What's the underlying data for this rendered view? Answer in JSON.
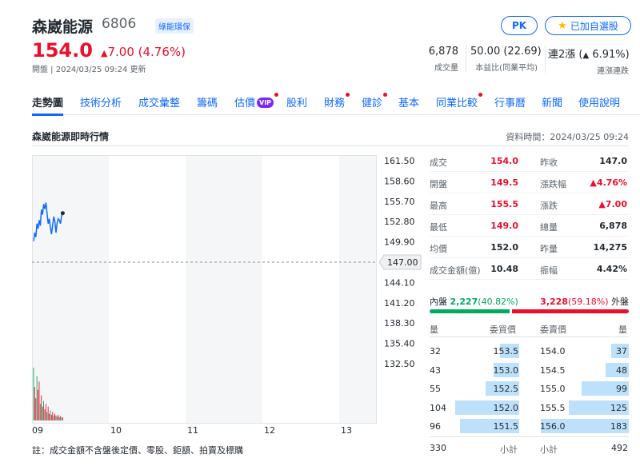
{
  "header": {
    "name": "森崴能源",
    "code": "6806",
    "sector": "綠能環保",
    "pk_label": "PK",
    "watch_label": "已加自選股",
    "price": "154.0",
    "change": "7.00 (4.76%)",
    "status_prefix": "開盤",
    "status_time": "2024/03/25 09:24 更新"
  },
  "stats": {
    "volume": {
      "value": "6,878",
      "label": "成交量"
    },
    "pe": {
      "value": "50.00 (22.69)",
      "label": "本益比(同業平均)"
    },
    "streak": {
      "value_prefix": "連2漲",
      "value_pct": "6.91%",
      "label": "連漲連跌"
    }
  },
  "tabs": [
    "走勢圖",
    "技術分析",
    "成交彙整",
    "籌碼",
    "估價",
    "股利",
    "財務",
    "健診",
    "基本",
    "同業比較",
    "行事曆",
    "新聞",
    "使用說明"
  ],
  "vip_label": "VIP",
  "section": {
    "title": "森崴能源即時行情",
    "data_time": "資料時間：2024/03/25 09:24"
  },
  "chart_data": {
    "type": "line",
    "x_ticks": [
      "09",
      "10",
      "11",
      "12",
      "13"
    ],
    "y_ticks": [
      "161.50",
      "158.60",
      "155.70",
      "152.80",
      "149.90",
      "147.00",
      "144.10",
      "141.20",
      "138.30",
      "135.40",
      "132.50"
    ],
    "ylim": [
      132.5,
      161.5
    ],
    "reference_price": 147.0,
    "reference_label": "147.00",
    "series": [
      {
        "values": [
          150.0,
          151.2,
          150.6,
          152.5,
          151.8,
          153.0,
          152.2,
          154.5,
          153.8,
          155.3,
          154.6,
          155.5,
          154.0,
          152.5,
          153.2,
          152.0,
          151.0,
          152.3,
          153.5,
          152.8,
          151.2,
          152.6,
          153.2,
          153.0,
          152.5,
          153.6,
          154.0
        ]
      }
    ],
    "volume_bars": [
      95,
      60,
      40,
      80,
      55,
      70,
      30,
      45,
      25,
      35,
      20,
      30,
      15,
      25,
      12,
      18,
      10,
      15,
      8,
      12,
      9,
      7,
      10,
      6,
      8,
      5,
      6
    ]
  },
  "footnote": "註：成交金額不含盤後定價、零股、鉅額、拍賣及標購",
  "quote": [
    {
      "l1": "成交",
      "v1": "154.0",
      "c1": "red",
      "l2": "昨收",
      "v2": "147.0",
      "c2": "black"
    },
    {
      "l1": "開盤",
      "v1": "149.5",
      "c1": "red",
      "l2": "漲跌幅",
      "v2": "▲4.76%",
      "c2": "red"
    },
    {
      "l1": "最高",
      "v1": "155.5",
      "c1": "red",
      "l2": "漲跌",
      "v2": "▲7.00",
      "c2": "red"
    },
    {
      "l1": "最低",
      "v1": "149.0",
      "c1": "red",
      "l2": "總量",
      "v2": "6,878",
      "c2": "black"
    },
    {
      "l1": "均價",
      "v1": "152.0",
      "c1": "black",
      "l2": "昨量",
      "v2": "14,275",
      "c2": "black"
    },
    {
      "l1": "成交金額(億)",
      "v1": "10.48",
      "c1": "black",
      "l2": "振幅",
      "v2": "4.42%",
      "c2": "black"
    }
  ],
  "inout": {
    "in_label": "內盤",
    "in_value": "2,227",
    "in_pct": "(40.82%)",
    "in_fraction": 0.4082,
    "out_value": "3,228",
    "out_pct": "(59.18%)",
    "out_label": "外盤"
  },
  "orderbook": {
    "headers": {
      "bid_qty": "量",
      "bid_price": "委買價",
      "ask_price": "委賣價",
      "ask_qty": "量"
    },
    "rows": [
      {
        "bid_qty": "32",
        "bid_price": "153.5",
        "ask_price": "154.0",
        "ask_qty": "37",
        "bid_frac": 0.3,
        "ask_frac": 0.2
      },
      {
        "bid_qty": "43",
        "bid_price": "153.0",
        "ask_price": "154.5",
        "ask_qty": "48",
        "bid_frac": 0.4,
        "ask_frac": 0.26
      },
      {
        "bid_qty": "55",
        "bid_price": "152.5",
        "ask_price": "155.0",
        "ask_qty": "99",
        "bid_frac": 0.53,
        "ask_frac": 0.54
      },
      {
        "bid_qty": "104",
        "bid_price": "152.0",
        "ask_price": "155.5",
        "ask_qty": "125",
        "bid_frac": 1.0,
        "ask_frac": 0.68
      },
      {
        "bid_qty": "96",
        "bid_price": "151.5",
        "ask_price": "156.0",
        "ask_qty": "183",
        "bid_frac": 0.92,
        "ask_frac": 1.0
      }
    ],
    "total_bid": "330",
    "total_label": "小計",
    "total_ask": "492"
  }
}
